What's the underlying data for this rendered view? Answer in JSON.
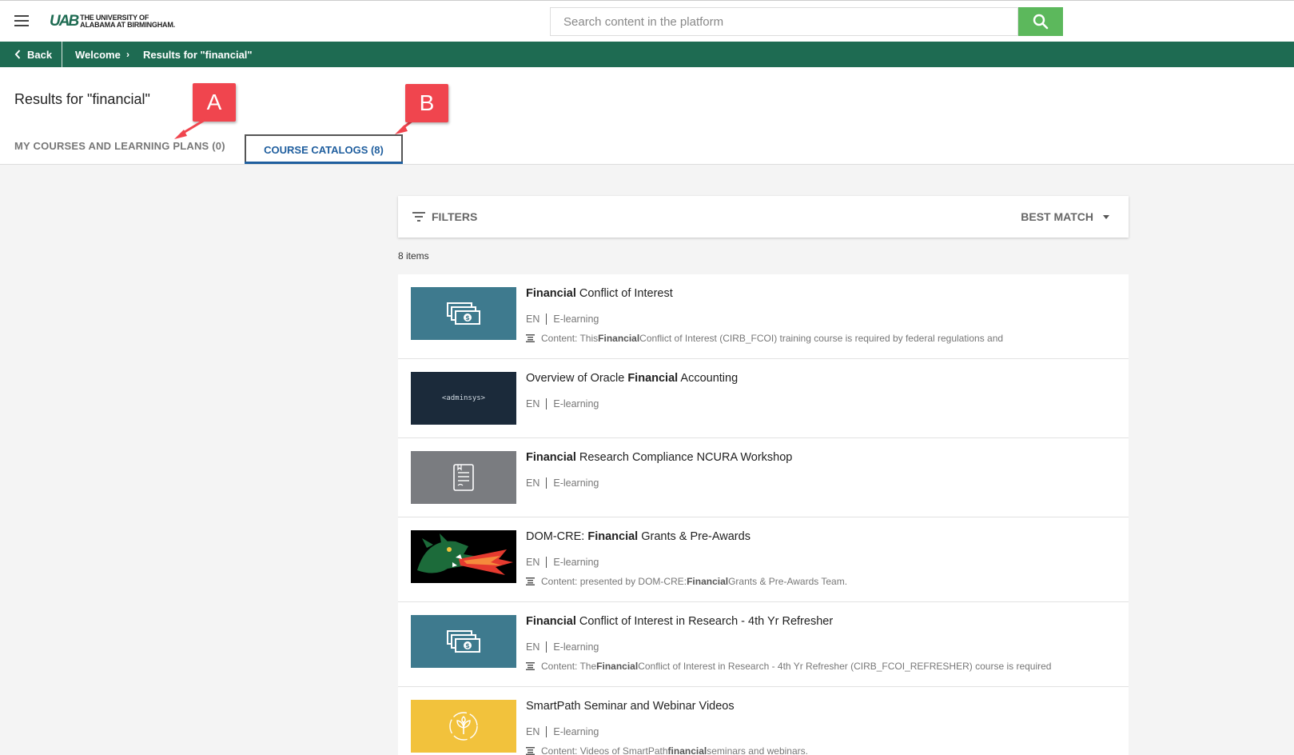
{
  "header": {
    "logo_mark": "UAB",
    "logo_line1": "THE UNIVERSITY OF",
    "logo_line2": "ALABAMA AT BIRMINGHAM.",
    "search_placeholder": "Search content in the platform"
  },
  "breadcrumb": {
    "back": "Back",
    "welcome": "Welcome",
    "separator": "›",
    "current": "Results for \"financial\""
  },
  "page": {
    "title": "Results for \"financial\"",
    "tab_my_courses": "MY COURSES AND LEARNING PLANS (0)",
    "tab_catalogs": "COURSE CATALOGS (8)",
    "callout_a": "A",
    "callout_b": "B"
  },
  "filters": {
    "label": "FILTERS",
    "sort": "BEST MATCH"
  },
  "items_count": "8 items",
  "results": [
    {
      "title_bold": "Financial",
      "title_rest": " Conflict of Interest",
      "lang": "EN",
      "type": "E-learning",
      "content_pre": "Content: This ",
      "content_bold": "Financial",
      "content_post": " Conflict of Interest (CIRB_FCOI) training course is required by federal regulations and",
      "thumb": "money-icon",
      "thumb_color": "#3e7a8e"
    },
    {
      "title_pre": "Overview of Oracle ",
      "title_bold": "Financial",
      "title_rest": " Accounting",
      "lang": "EN",
      "type": "E-learning",
      "thumb_text": "<adminsys>",
      "thumb_color": "#1b2a3a"
    },
    {
      "title_bold": "Financial",
      "title_rest": " Research Compliance NCURA Workshop",
      "lang": "EN",
      "type": "E-learning",
      "thumb": "document-icon",
      "thumb_color": "#7a7c80"
    },
    {
      "title_pre": "DOM-CRE: ",
      "title_bold": "Financial",
      "title_rest": " Grants & Pre-Awards",
      "lang": "EN",
      "type": "E-learning",
      "content_pre": "Content: presented by DOM-CRE: ",
      "content_bold": "Financial",
      "content_post": " Grants & Pre-Awards Team.",
      "thumb": "dragon-image",
      "thumb_color": "#000000"
    },
    {
      "title_bold": "Financial",
      "title_rest": " Conflict of Interest in Research - 4th Yr Refresher",
      "lang": "EN",
      "type": "E-learning",
      "content_pre": "Content: The ",
      "content_bold": "Financial",
      "content_post": " Conflict of Interest in Research - 4th Yr Refresher (CIRB_FCOI_REFRESHER) course is required",
      "thumb": "money-icon",
      "thumb_color": "#3e7a8e"
    },
    {
      "title_pre": "SmartPath Seminar and Webinar Videos",
      "lang": "EN",
      "type": "E-learning",
      "content_pre": "Content: Videos of SmartPath ",
      "content_bold": "financial",
      "content_post": " seminars and webinars.",
      "thumb": "growth-icon",
      "thumb_color": "#f2c23c"
    }
  ],
  "colors": {
    "brand_green": "#1e6b52",
    "search_green": "#5cb85c",
    "tab_blue": "#1f5e9e",
    "callout_red": "#f0454e"
  }
}
